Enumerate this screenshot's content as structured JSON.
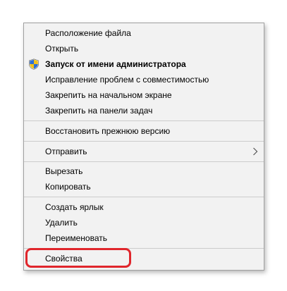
{
  "menu": {
    "items": [
      {
        "label": "Расположение файла"
      },
      {
        "label": "Открыть"
      },
      {
        "label": "Запуск от имени администратора",
        "icon": "uac-shield-icon"
      },
      {
        "label": "Исправление проблем с совместимостью"
      },
      {
        "label": "Закрепить на начальном экране"
      },
      {
        "label": "Закрепить на панели задач"
      },
      {
        "label": "Восстановить прежнюю версию"
      },
      {
        "label": "Отправить",
        "icon": "chevron-right-icon"
      },
      {
        "label": "Вырезать"
      },
      {
        "label": "Копировать"
      },
      {
        "label": "Создать ярлык"
      },
      {
        "label": "Удалить"
      },
      {
        "label": "Переименовать"
      },
      {
        "label": "Свойства"
      }
    ]
  },
  "colors": {
    "menu_background": "#f2f2f2",
    "menu_border": "#a0a0a0",
    "separator": "#cccccc",
    "highlight_outline": "#e0262c"
  }
}
